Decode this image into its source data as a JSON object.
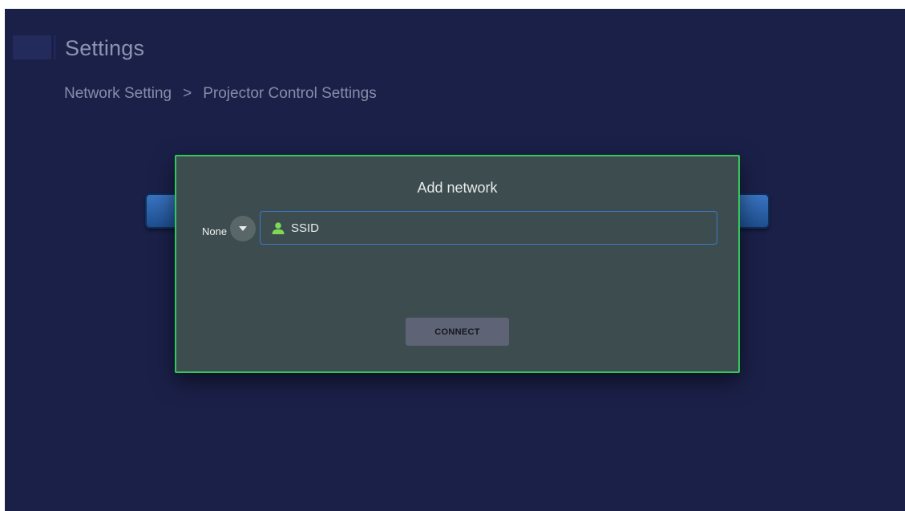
{
  "header": {
    "title": "Settings"
  },
  "breadcrumb": {
    "items": [
      "Network Setting",
      "Projector Control Settings"
    ],
    "separator": ">"
  },
  "dialog": {
    "title": "Add network",
    "security": {
      "selected_value": "None",
      "dropdown_icon": "chevron-down-icon"
    },
    "ssid": {
      "value": "SSID",
      "icon": "person-icon",
      "icon_color": "#7ed957"
    },
    "connect_label": "CONNECT"
  },
  "colors": {
    "background": "#1b2049",
    "dialog_background": "#3d4c4f",
    "dialog_border": "#34c759",
    "field_border": "#3b78c9",
    "button_background": "#5f6376"
  }
}
